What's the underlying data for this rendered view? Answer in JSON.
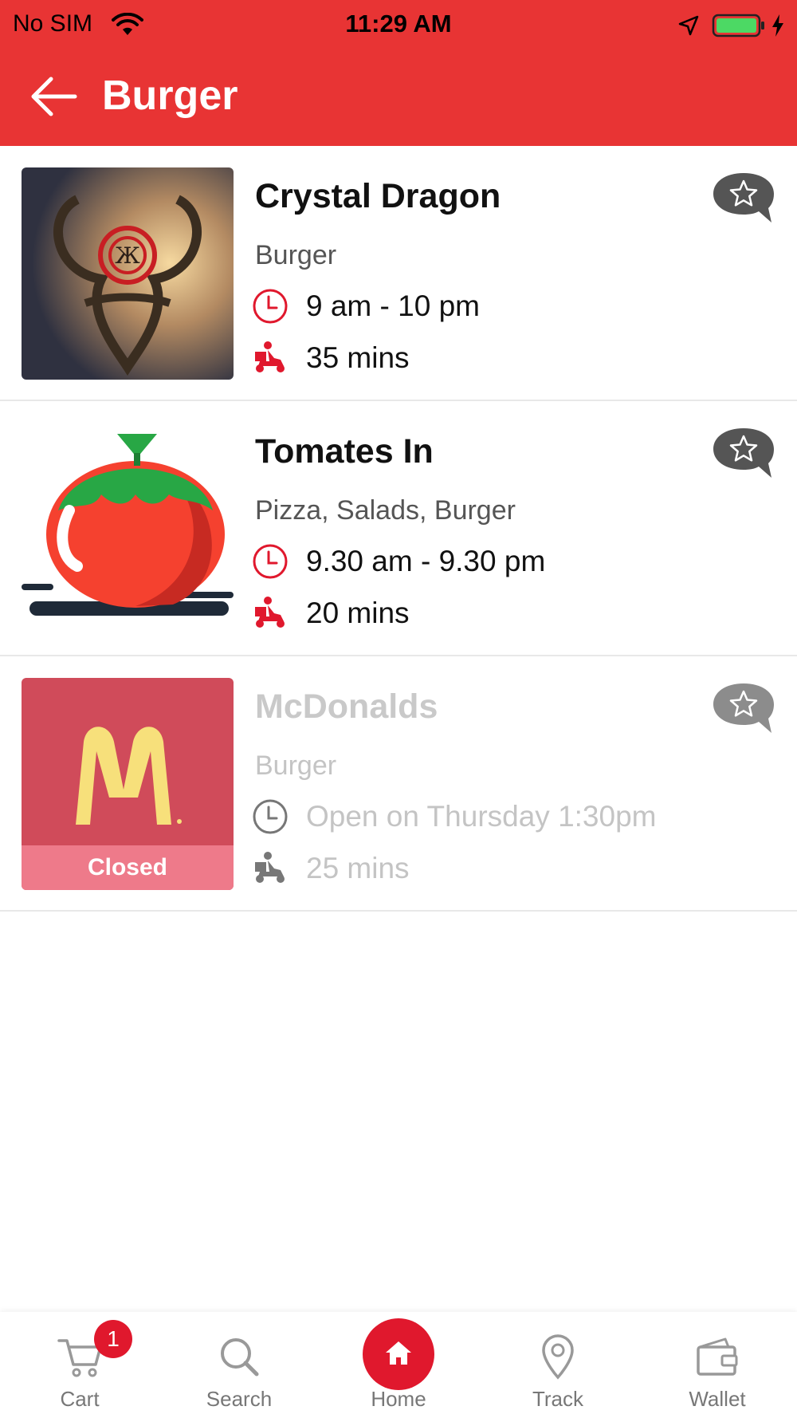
{
  "status_bar": {
    "carrier": "No SIM",
    "time": "11:29 AM"
  },
  "header": {
    "title": "Burger"
  },
  "restaurants": [
    {
      "name": "Crystal Dragon",
      "cuisine": "Burger",
      "hours": "9 am - 10 pm",
      "delivery_time": "35 mins",
      "closed": false
    },
    {
      "name": "Tomates In",
      "cuisine": "Pizza, Salads, Burger",
      "hours": "9.30 am - 9.30 pm",
      "delivery_time": "20 mins",
      "closed": false
    },
    {
      "name": "McDonalds",
      "cuisine": "Burger",
      "hours": "Open on Thursday 1:30pm",
      "delivery_time": "25 mins",
      "closed": true,
      "closed_label": "Closed"
    }
  ],
  "tabbar": {
    "cart_label": "Cart",
    "cart_badge": "1",
    "search_label": "Search",
    "home_label": "Home",
    "track_label": "Track",
    "wallet_label": "Wallet"
  },
  "colors": {
    "brand_red": "#e83434",
    "accent_red": "#e0182d",
    "closed_band": "#ee7a8a"
  }
}
